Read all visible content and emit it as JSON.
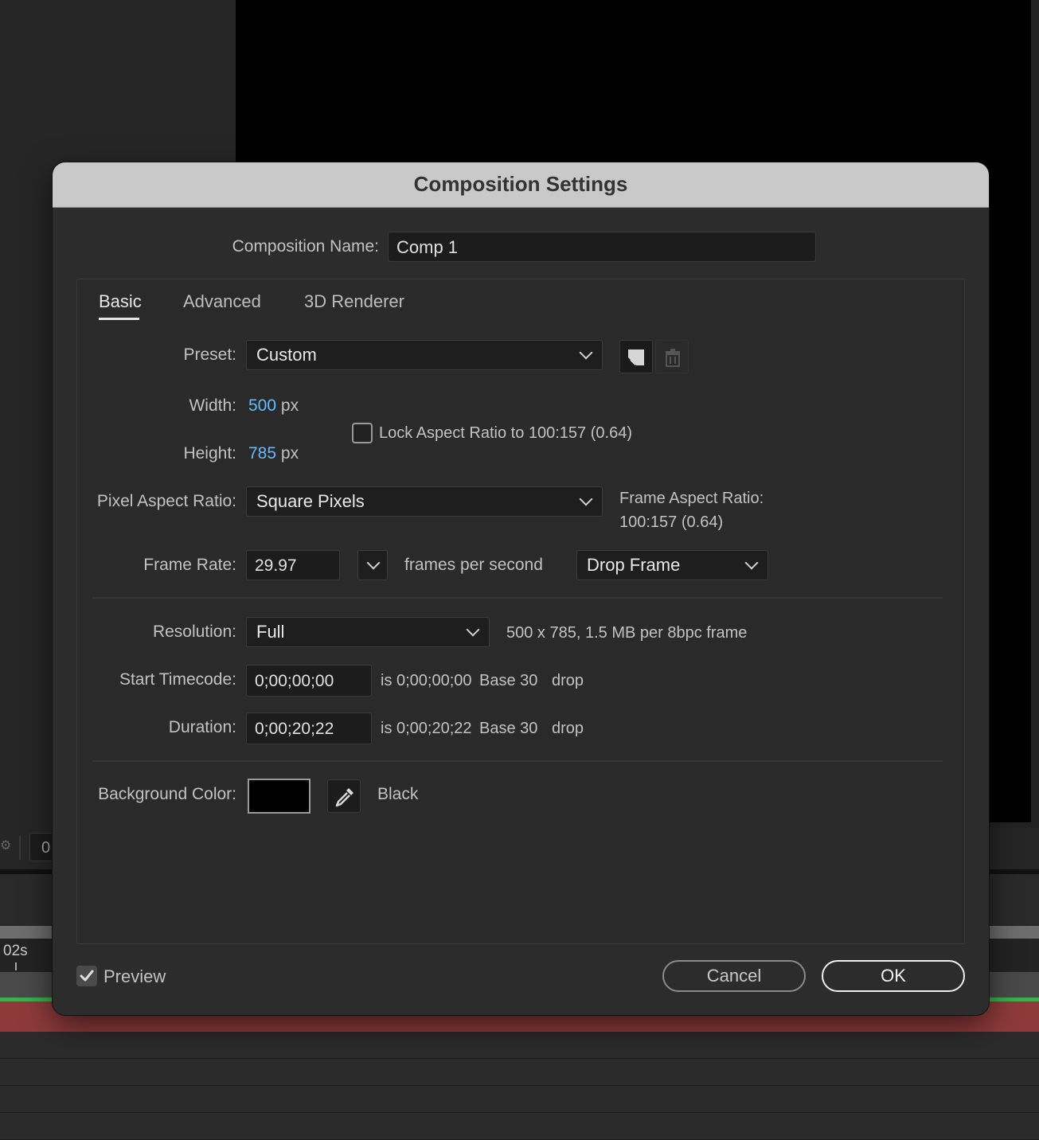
{
  "background": {
    "toolbar_field_value": "0",
    "ruler_label": "02s"
  },
  "dialog": {
    "title": "Composition Settings",
    "comp_name_label": "Composition Name:",
    "comp_name_value": "Comp 1",
    "tabs": [
      {
        "label": "Basic",
        "active": true
      },
      {
        "label": "Advanced",
        "active": false
      },
      {
        "label": "3D Renderer",
        "active": false
      }
    ],
    "preset": {
      "label": "Preset:",
      "value": "Custom"
    },
    "width": {
      "label": "Width:",
      "value": "500",
      "unit": "px"
    },
    "height": {
      "label": "Height:",
      "value": "785",
      "unit": "px"
    },
    "lock_aspect": {
      "label": "Lock Aspect Ratio to 100:157 (0.64)",
      "checked": false
    },
    "pixel_aspect": {
      "label": "Pixel Aspect Ratio:",
      "value": "Square Pixels"
    },
    "frame_aspect": {
      "label": "Frame Aspect Ratio:",
      "value": "100:157 (0.64)"
    },
    "frame_rate": {
      "label": "Frame Rate:",
      "value": "29.97",
      "unit_label": "frames per second",
      "drop_value": "Drop Frame"
    },
    "resolution": {
      "label": "Resolution:",
      "value": "Full",
      "info": "500 x 785, 1.5 MB per 8bpc frame"
    },
    "start_timecode": {
      "label": "Start Timecode:",
      "value": "0;00;00;00",
      "is_text": "is 0;00;00;00",
      "base": "Base 30",
      "drop": "drop"
    },
    "duration": {
      "label": "Duration:",
      "value": "0;00;20;22",
      "is_text": "is 0;00;20;22",
      "base": "Base 30",
      "drop": "drop"
    },
    "background_color": {
      "label": "Background Color:",
      "name": "Black",
      "color": "#000000"
    },
    "preview": {
      "label": "Preview",
      "checked": true
    },
    "cancel_label": "Cancel",
    "ok_label": "OK"
  },
  "colors": {
    "accent_number": "#69b9ff",
    "timeline_layer": "#8e3a3a",
    "work_area_green": "#32b54a"
  },
  "icons": [
    "chevron-down-icon",
    "new-preset-icon",
    "trash-icon",
    "eyedropper-icon",
    "checkmark-icon"
  ]
}
